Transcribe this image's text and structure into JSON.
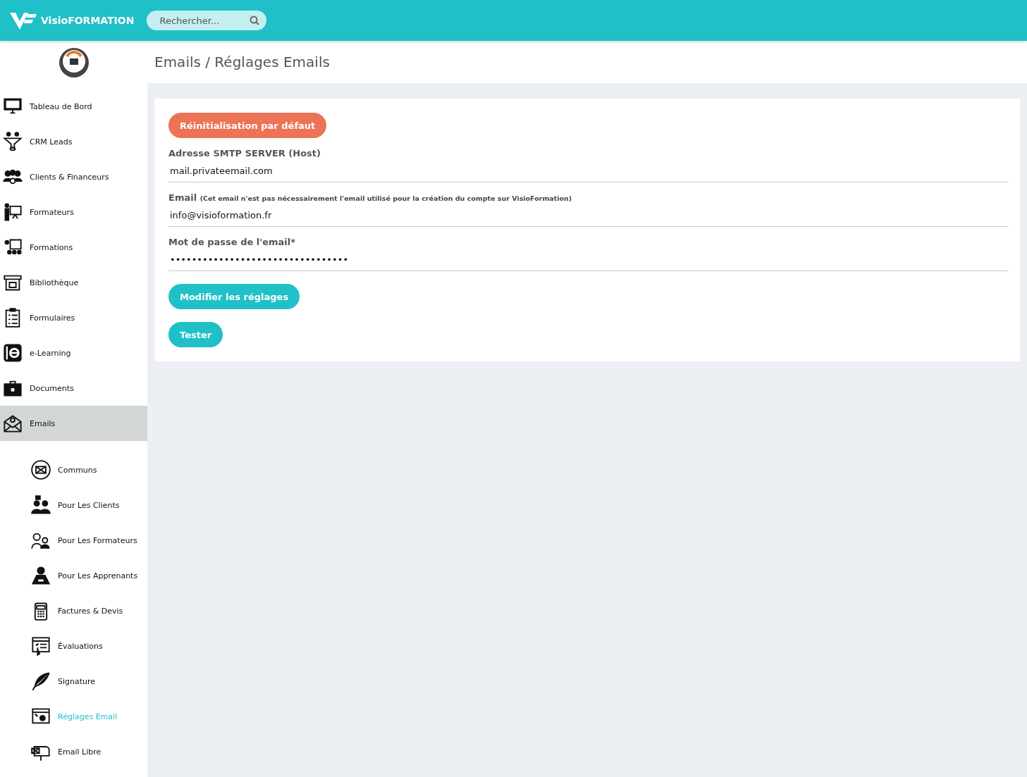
{
  "header": {
    "brand": "VisioFORMATION",
    "search": {
      "placeholder": "Rechercher..."
    }
  },
  "sidebar": {
    "items": [
      {
        "label": "Tableau de Bord",
        "selected": false
      },
      {
        "label": "CRM Leads",
        "selected": false
      },
      {
        "label": "Clients & Financeurs",
        "selected": false
      },
      {
        "label": "Formateurs",
        "selected": false
      },
      {
        "label": "Formations",
        "selected": false
      },
      {
        "label": "Bibliothèque",
        "selected": false
      },
      {
        "label": "Formulaires",
        "selected": false
      },
      {
        "label": "e-Learning",
        "selected": false
      },
      {
        "label": "Documents",
        "selected": false
      },
      {
        "label": "Emails",
        "selected": true,
        "expanded": true,
        "children": [
          {
            "label": "Communs",
            "selected": false
          },
          {
            "label": "Pour Les Clients",
            "selected": false
          },
          {
            "label": "Pour Les Formateurs",
            "selected": false
          },
          {
            "label": "Pour Les Apprenants",
            "selected": false
          },
          {
            "label": "Factures & Devis",
            "selected": false
          },
          {
            "label": "Évaluations",
            "selected": false
          },
          {
            "label": "Signature",
            "selected": false
          },
          {
            "label": "Réglages Email",
            "selected": true
          },
          {
            "label": "Email Libre",
            "selected": false
          }
        ]
      }
    ]
  },
  "page": {
    "title": "Emails / Réglages Emails"
  },
  "form": {
    "reset_button": "Réinitialisation par défaut",
    "fields": [
      {
        "label": "Adresse SMTP SERVER (Host)",
        "value": "mail.privateemail.com"
      },
      {
        "label": "Email",
        "note": "(Cet email n'est pas nécessairement l'email utilisé pour la création du compte sur VisioFormation)",
        "value": "info@visioformation.fr"
      },
      {
        "label": "Mot de passe de l'email*",
        "value": "•••••••••••••••••••••••••••••••••"
      }
    ],
    "buttons": [
      "Modifier les réglages",
      "Tester"
    ]
  }
}
